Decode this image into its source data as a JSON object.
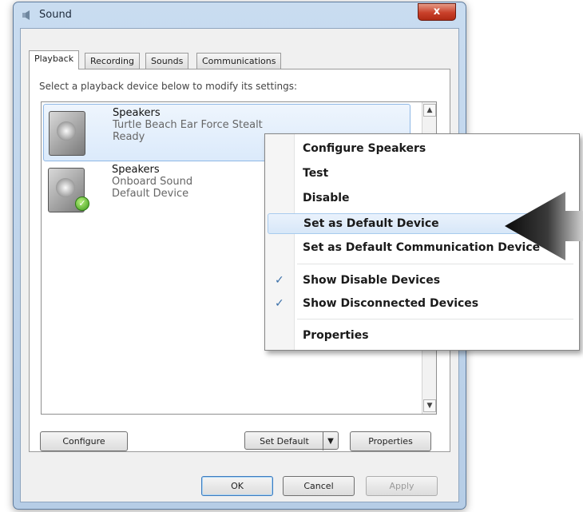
{
  "window": {
    "title": "Sound",
    "close_glyph": "x",
    "icon": "sound-icon"
  },
  "tabs": [
    {
      "label": "Playback"
    },
    {
      "label": "Recording"
    },
    {
      "label": "Sounds"
    },
    {
      "label": "Communications"
    }
  ],
  "instructions": "Select a playback device below to modify its settings:",
  "devices": [
    {
      "name": "Speakers",
      "description": "Turtle Beach Ear Force Stealt",
      "status": "Ready",
      "selected": true
    },
    {
      "name": "Speakers",
      "description": "Onboard Sound",
      "status": "Default Device",
      "selected": false,
      "badge": "default-check-badge"
    }
  ],
  "scroll": {
    "up_glyph": "▲",
    "down_glyph": "▼"
  },
  "buttons": {
    "configure": "Configure",
    "set_default": "Set Default",
    "set_default_arrow": "▼",
    "properties": "Properties",
    "ok": "OK",
    "cancel": "Cancel",
    "apply": "Apply"
  },
  "context_menu": {
    "items": [
      {
        "label": "Configure Speakers"
      },
      {
        "label": "Test"
      },
      {
        "label": "Disable"
      },
      {
        "label": "Set as Default Device",
        "highlighted": true
      },
      {
        "label": "Set as Default Communication Device"
      },
      {
        "label": "Show Disable Devices",
        "checked": true
      },
      {
        "label": "Show Disconnected Devices",
        "checked": true
      },
      {
        "label": "Properties"
      }
    ],
    "check_glyph": "✓"
  },
  "callout": {
    "direction": "left",
    "color": "#111111"
  }
}
